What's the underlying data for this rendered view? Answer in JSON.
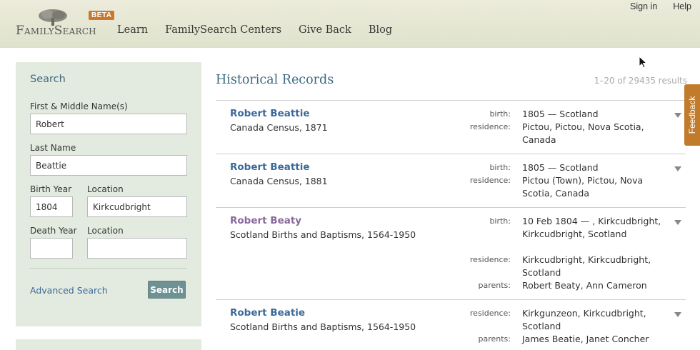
{
  "header": {
    "logo_text": "FamilySearch",
    "beta_label": "BETA",
    "nav": [
      "Learn",
      "FamilySearch Centers",
      "Give Back",
      "Blog"
    ],
    "sign_in": "Sign in",
    "help": "Help"
  },
  "sidebar": {
    "title": "Search",
    "first_label": "First & Middle Name(s)",
    "first_value": "Robert",
    "last_label": "Last Name",
    "last_value": "Beattie",
    "birth_year_label": "Birth Year",
    "birth_year_value": "1804",
    "birth_location_label": "Location",
    "birth_location_value": "Kirkcudbright",
    "death_year_label": "Death Year",
    "death_year_value": "",
    "death_location_label": "Location",
    "death_location_value": "",
    "advanced_link": "Advanced Search",
    "search_button": "Search"
  },
  "results": {
    "title": "Historical Records",
    "count": "1–20 of 29435 results",
    "records": [
      {
        "name": "Robert Beattie",
        "collection": "Canada Census, 1871",
        "fields": [
          {
            "key": "birth:",
            "value": "1805 — Scotland"
          },
          {
            "key": "residence:",
            "value": "Pictou, Pictou, Nova Scotia, Canada"
          }
        ]
      },
      {
        "name": "Robert Beattie",
        "collection": "Canada Census, 1881",
        "fields": [
          {
            "key": "birth:",
            "value": "1805 — Scotland"
          },
          {
            "key": "residence:",
            "value": "Pictou (Town), Pictou, Nova Scotia, Canada"
          }
        ]
      },
      {
        "name": "Robert Beaty",
        "collection": "Scotland Births and Baptisms, 1564-1950",
        "fields": [
          {
            "key": "birth:",
            "value": "10 Feb 1804 — , Kirkcudbright, Kirkcudbright, Scotland"
          },
          {
            "key": "residence:",
            "value": "Kirkcudbright, Kirkcudbright, Scotland"
          },
          {
            "key": "parents:",
            "value": "Robert Beaty, Ann Cameron"
          }
        ]
      },
      {
        "name": "Robert Beatie",
        "collection": "Scotland Births and Baptisms, 1564-1950",
        "fields": [
          {
            "key": "residence:",
            "value": "Kirkgunzeon, Kirkcudbright, Scotland"
          },
          {
            "key": "parents:",
            "value": "James Beatie, Janet Concher"
          }
        ]
      }
    ]
  },
  "feedback_tab": "Feedback"
}
